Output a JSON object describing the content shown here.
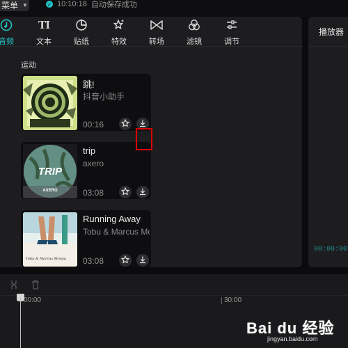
{
  "topbar": {
    "menu_label": "菜单",
    "save_time": "10:10:18",
    "save_status": "自动保存成功"
  },
  "tabs": [
    {
      "label": "音频",
      "icon": "audio-icon",
      "active": true
    },
    {
      "label": "文本",
      "icon": "text-icon",
      "glyph": "TI"
    },
    {
      "label": "贴纸",
      "icon": "sticker-icon"
    },
    {
      "label": "特效",
      "icon": "effects-icon"
    },
    {
      "label": "转场",
      "icon": "transition-icon"
    },
    {
      "label": "滤镜",
      "icon": "filter-icon"
    },
    {
      "label": "调节",
      "icon": "adjust-icon"
    }
  ],
  "category": "运动",
  "tracks": [
    {
      "title": "跳!",
      "artist": "抖音小助手",
      "duration": "00:16"
    },
    {
      "title": "trip",
      "artist": "axero",
      "duration": "03:08",
      "cover_text": "TRIP",
      "cover_brand": "AXERO"
    },
    {
      "title": "Running Away",
      "artist": "Tobu & Marcus Mouya",
      "duration": "03:08",
      "cover_text": "Tobu & Marcus Mouya"
    }
  ],
  "player": {
    "title": "播放器",
    "timecode": "00:00:00"
  },
  "timeline": {
    "ticks": [
      "00:00",
      "30:00"
    ]
  },
  "watermark": {
    "main": "Bai du 经验",
    "sub": "jingyan.baidu.com"
  },
  "colors": {
    "accent": "#22c3c8",
    "highlight": "#e00000",
    "panel": "#1d1d1f",
    "background": "#0b0b0d"
  }
}
